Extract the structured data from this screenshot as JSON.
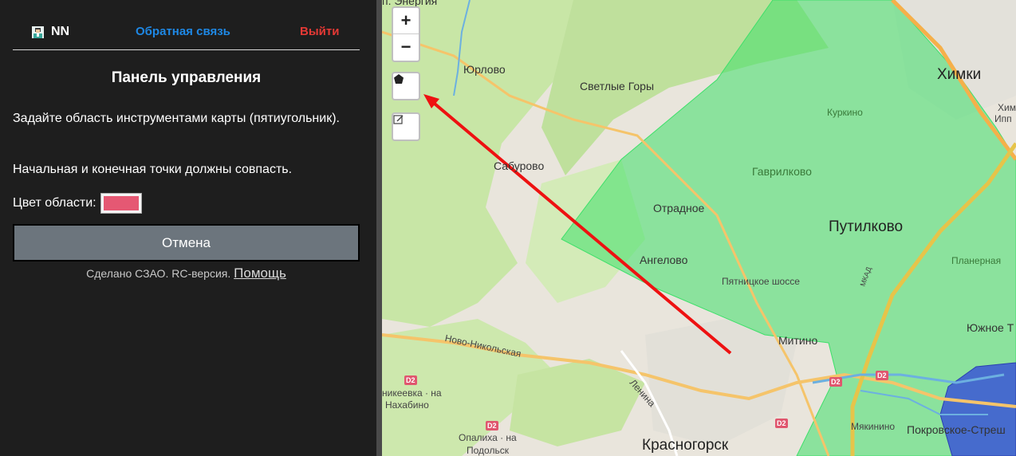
{
  "header": {
    "user_name": "NN",
    "feedback_label": "Обратная связь",
    "logout_label": "Выйти"
  },
  "panel": {
    "title": "Панель управления",
    "instruction_text": "Задайте область инструментами карты (пятиугольник).",
    "instruction_note": "Начальная и конечная точки должны совпасть.",
    "color_label": "Цвет области:",
    "color_value": "#e55873",
    "cancel_label": "Отмена",
    "footer_text": "Сделано СЗАО. RC-версия.",
    "help_label": "Помощь"
  },
  "map": {
    "controls": {
      "zoom_in": "+",
      "zoom_out": "−",
      "draw_polygon_icon": "pentagon-icon",
      "edit_layers_icon": "edit-icon"
    },
    "labels": {
      "energia": "п. Энергия",
      "yurlovo": "Юрлово",
      "svetlye_gory": "Светлые Горы",
      "khimki": "Химки",
      "kurkino": "Куркино",
      "saburovo": "Сабурово",
      "gavrilkovo": "Гаврилково",
      "otradnoe": "Отрадное",
      "putilkovo": "Путилково",
      "angelovo": "Ангелово",
      "pyatnitskoe": "Пятницкое шоссе",
      "planernaya": "Планерная",
      "mitino": "Митино",
      "yuzhnoe": "Южное Т",
      "novo_nikolskaya": "Ново-Никольская",
      "lenina": "Ленина",
      "nikeevka": "никеевка · на",
      "nakhabino": "Нахабино",
      "myakinino": "Мякинино",
      "pokrovskoe": "Покровское-Стреш",
      "opalikha": "Опалиха · на",
      "podolsk": "Подольск",
      "krasnogorsk": "Красногорск",
      "mkad": "МКАД",
      "ipp": "Ипп",
      "khimki_ipp": "Хим"
    },
    "road_badges": [
      "D2",
      "D2",
      "D2",
      "D2",
      "D2"
    ],
    "colors": {
      "green_zone": "#3ee06a",
      "blue_zone": "#3a56d6",
      "arrow": "#ee1111"
    }
  }
}
